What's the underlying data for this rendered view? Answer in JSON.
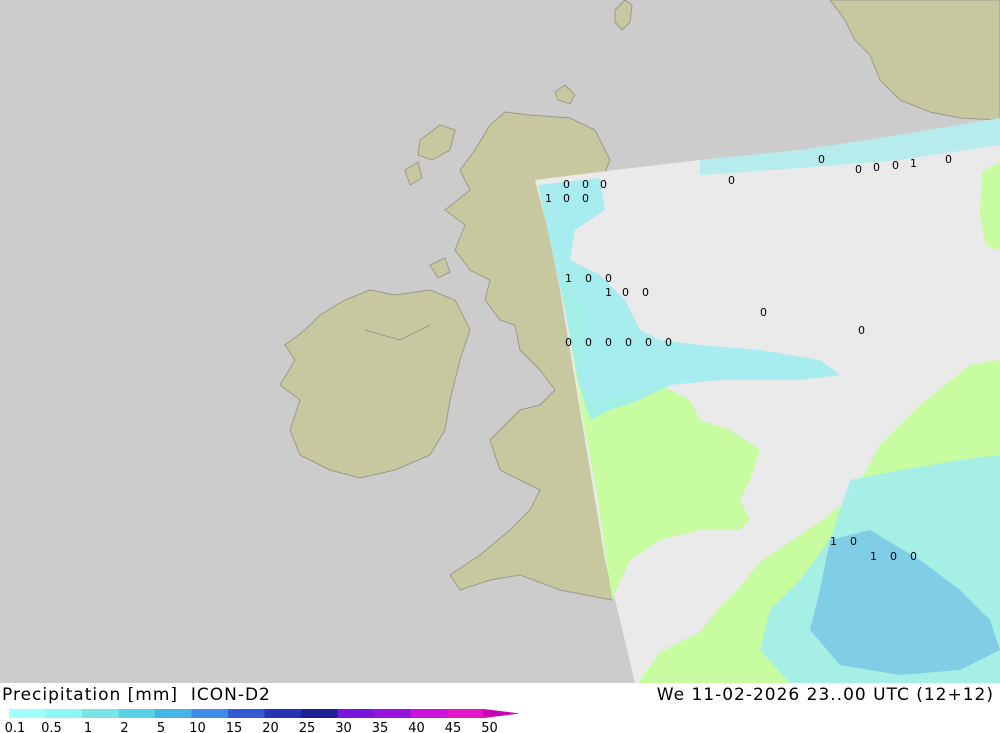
{
  "header": {
    "title": "Precipitation [mm]  ICON-D2",
    "valid_time": "We 11-02-2026 23..00 UTC (12+12)"
  },
  "legend": {
    "labels": [
      "0.1",
      "0.5",
      "1",
      "2",
      "5",
      "10",
      "15",
      "20",
      "25",
      "30",
      "35",
      "40",
      "45",
      "50"
    ],
    "colors": [
      "#a0ffff",
      "#8cf5f5",
      "#78e6e6",
      "#5ad2e6",
      "#46b4e6",
      "#3c8ce6",
      "#325ad2",
      "#2832b4",
      "#1e1e96",
      "#7814dc",
      "#9614dc",
      "#c814dc",
      "#e614c8",
      "#c800b4"
    ]
  },
  "map": {
    "colors": {
      "sea": "#cccccc",
      "land": "#c8c8a0",
      "domain": "#ebebeb",
      "rain_light": "#c8fca0",
      "rain_cyan": "#a0ecf0",
      "rain_mid": "#78c8e6"
    },
    "precip_labels": [
      [
        "0",
        "0",
        "0"
      ],
      [
        "1",
        "0",
        "0",
        "0"
      ],
      [
        "1",
        "0",
        "0",
        "1",
        "0",
        "0"
      ],
      [
        "0",
        "0",
        "0",
        "0",
        "0",
        "0",
        "0",
        "0",
        "0",
        "0",
        "0",
        "0",
        "1",
        "0"
      ],
      [
        "1",
        "0",
        "1",
        "0",
        "0"
      ]
    ]
  }
}
